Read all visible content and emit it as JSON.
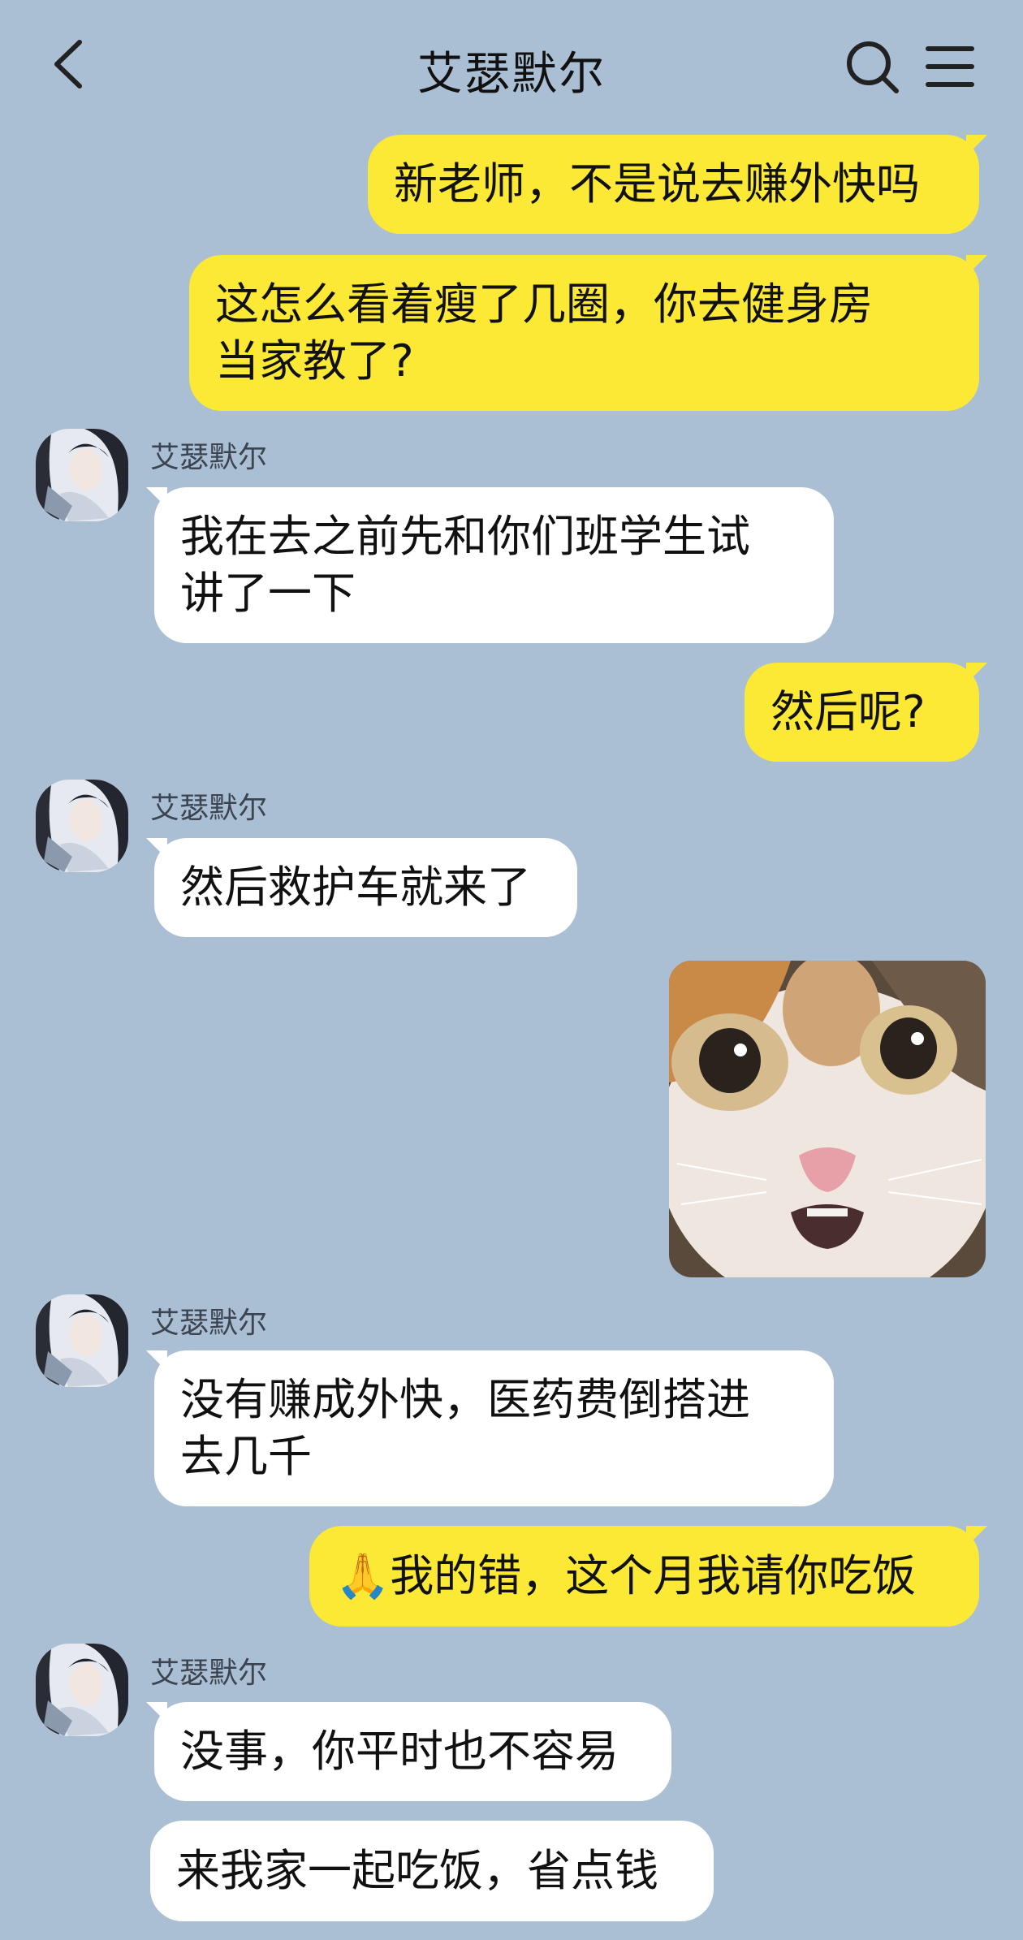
{
  "header": {
    "title": "艾瑟默尔",
    "icons": {
      "back": "chevron-left-icon",
      "search": "search-icon",
      "menu": "hamburger-menu-icon"
    }
  },
  "colors": {
    "background": "#aabfd3",
    "outgoing_bubble": "#fbe935",
    "incoming_bubble": "#ffffff"
  },
  "messages": [
    {
      "direction": "out",
      "text": "新老师，不是说去赚外快吗"
    },
    {
      "direction": "out",
      "text": "这怎么看着瘦了几圈，你去健身房\n当家教了?"
    },
    {
      "direction": "in",
      "sender": "艾瑟默尔",
      "text": "我在去之前先和你们班学生试\n讲了一下"
    },
    {
      "direction": "out",
      "text": "然后呢?"
    },
    {
      "direction": "in",
      "sender": "艾瑟默尔",
      "text": "然后救护车就来了"
    },
    {
      "direction": "out",
      "type": "sticker",
      "sticker": "surprised-cat"
    },
    {
      "direction": "in",
      "sender": "艾瑟默尔",
      "text": "没有赚成外快，医药费倒搭进\n去几千"
    },
    {
      "direction": "out",
      "text": "🙏我的错，这个月我请你吃饭"
    },
    {
      "direction": "in",
      "sender": "艾瑟默尔",
      "text": "没事，你平时也不容易"
    },
    {
      "direction": "in",
      "text": "来我家一起吃饭，省点钱"
    }
  ]
}
